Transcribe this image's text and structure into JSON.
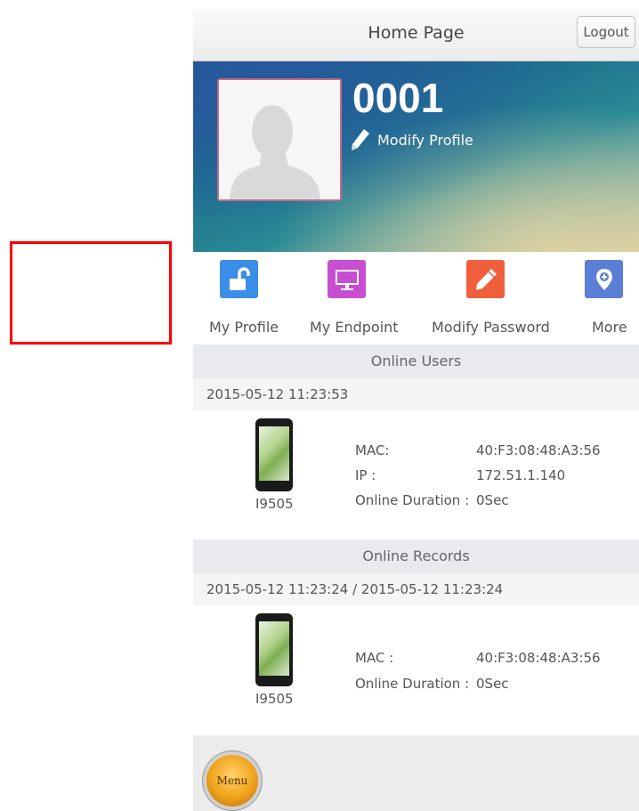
{
  "header": {
    "title": "Home Page",
    "logout_label": "Logout"
  },
  "profile": {
    "user_id": "0001",
    "modify_profile_label": "Modify Profile"
  },
  "shortcuts": [
    {
      "label": "My Profile",
      "icon": "unlock-icon",
      "color": "#3a8ee6"
    },
    {
      "label": "My Endpoint",
      "icon": "monitor-icon",
      "color": "#c84fd0"
    },
    {
      "label": "Modify Password",
      "icon": "pencil-icon",
      "color": "#ef5f3c"
    },
    {
      "label": "More",
      "icon": "location-plus-icon",
      "color": "#5b7fd6"
    }
  ],
  "online_users": {
    "title": "Online Users",
    "date": "2015-05-12 11:23:53",
    "device": {
      "name": "I9505",
      "mac_label": "MAC:",
      "mac_value": "40:F3:08:48:A3:56",
      "ip_label": "IP :",
      "ip_value": "172.51.1.140",
      "duration_label": "Online Duration :",
      "duration_value": "0Sec"
    }
  },
  "online_records": {
    "title": "Online Records",
    "date_range": "2015-05-12 11:23:24 / 2015-05-12 11:23:24",
    "device": {
      "name": "I9505",
      "mac_label": "MAC :",
      "mac_value": "40:F3:08:48:A3:56",
      "duration_label": "Online Duration :",
      "duration_value": "0Sec"
    }
  },
  "footer": {
    "menu_label": "Menu"
  }
}
